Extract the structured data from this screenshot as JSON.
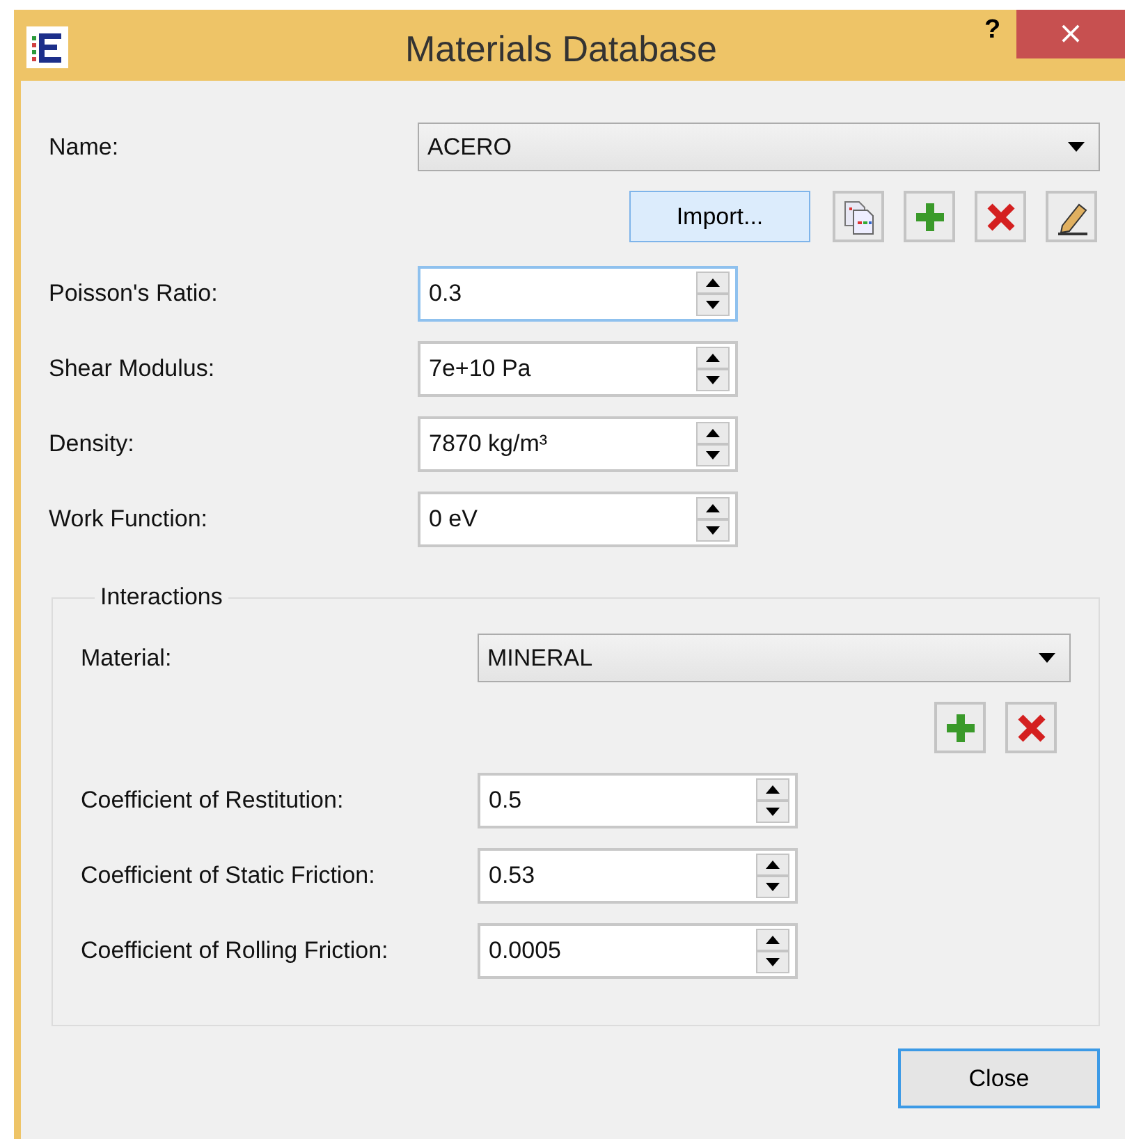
{
  "window": {
    "title": "Materials Database",
    "help": "?",
    "close": "×"
  },
  "name": {
    "label": "Name:",
    "value": "ACERO"
  },
  "import_button": {
    "label": "Import...",
    "highlighted": true
  },
  "properties": [
    {
      "label": "Poisson's Ratio:",
      "value": "0.3",
      "focused": true
    },
    {
      "label": "Shear Modulus:",
      "value": "7e+10 Pa",
      "focused": false
    },
    {
      "label": "Density:",
      "value": "7870 kg/m³",
      "focused": false
    },
    {
      "label": "Work Function:",
      "value": "0 eV",
      "focused": false
    }
  ],
  "interactions": {
    "title": "Interactions",
    "material": {
      "label": "Material:",
      "value": "MINERAL"
    },
    "coefficients": [
      {
        "label": "Coefficient of Restitution:",
        "value": "0.5",
        "focused": false
      },
      {
        "label": "Coefficient of Static Friction:",
        "value": "0.53",
        "focused": false
      },
      {
        "label": "Coefficient of Rolling Friction:",
        "value": "0.0005",
        "focused": false
      }
    ]
  },
  "close_button": {
    "label": "Close",
    "default": true
  }
}
